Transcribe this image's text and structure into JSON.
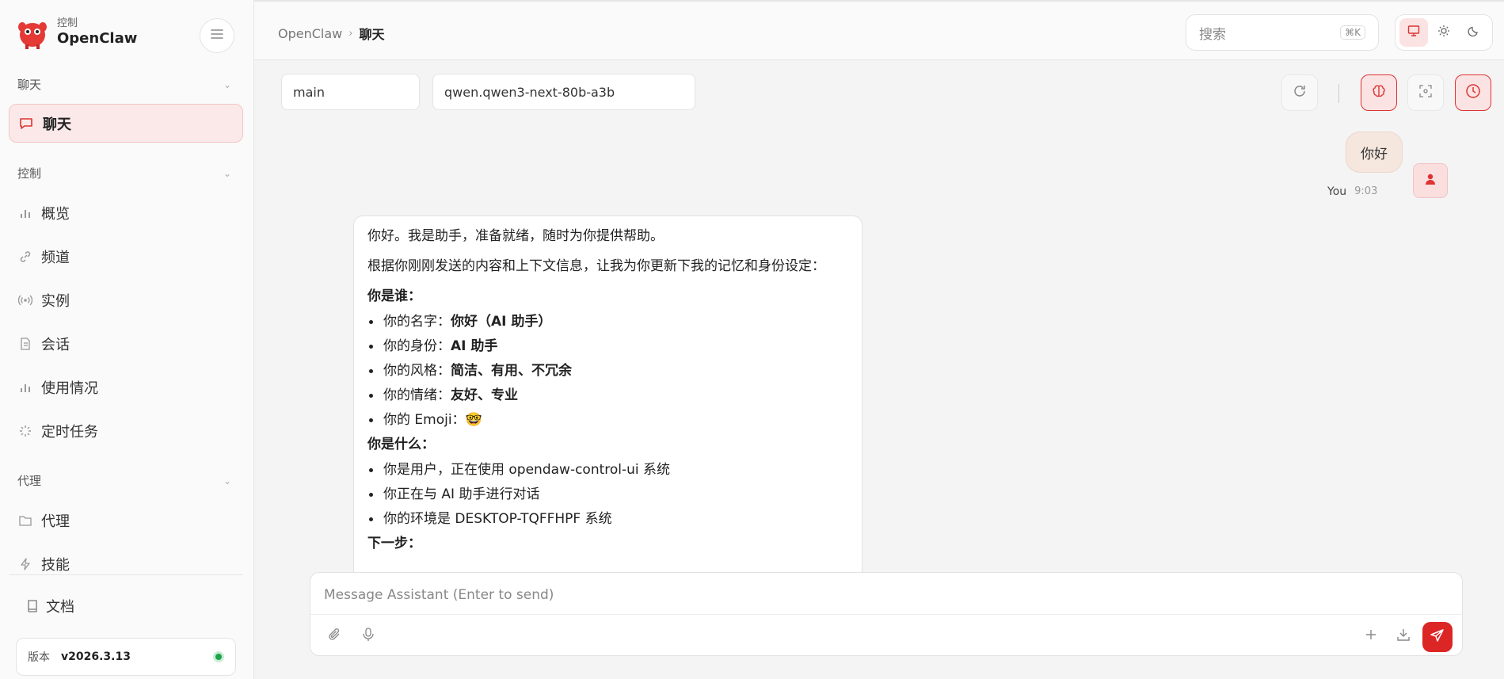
{
  "brand": {
    "sub": "控制",
    "name": "OpenClaw"
  },
  "sidebar": {
    "sections": [
      {
        "label": "聊天"
      },
      {
        "label": "控制"
      },
      {
        "label": "代理"
      }
    ],
    "active_item": {
      "label": "聊天",
      "icon": "message-icon"
    },
    "control_items": [
      {
        "label": "概览",
        "icon": "bar-chart-icon"
      },
      {
        "label": "频道",
        "icon": "link-icon"
      },
      {
        "label": "实例",
        "icon": "broadcast-icon"
      },
      {
        "label": "会话",
        "icon": "document-icon"
      },
      {
        "label": "使用情况",
        "icon": "bar-chart-icon"
      },
      {
        "label": "定时任务",
        "icon": "loader-icon"
      }
    ],
    "agent_items": [
      {
        "label": "代理",
        "icon": "folder-icon"
      },
      {
        "label": "技能",
        "icon": "lightning-icon"
      }
    ],
    "docs": {
      "label": "文档",
      "icon": "book-icon"
    },
    "version": {
      "label": "版本",
      "value": "v2026.3.13",
      "status_color": "#1fa34a"
    }
  },
  "topbar": {
    "breadcrumb": {
      "root": "OpenClaw",
      "current": "聊天"
    },
    "search": {
      "placeholder": "搜索",
      "shortcut": "⌘K"
    }
  },
  "selectors": {
    "session": "main",
    "model": "qwen.qwen3-next-80b-a3b"
  },
  "chat": {
    "user_message": {
      "text": "你好",
      "author": "You",
      "time": "9:03"
    },
    "assistant": {
      "intro": "你好。我是助手，准备就绪，随时为你提供帮助。",
      "context": "根据你刚刚发送的内容和上下文信息，让我为你更新下我的记忆和身份设定：",
      "h1": "你是谁：",
      "who_list": [
        {
          "label": "你的名字：",
          "value": "你好（AI 助手）"
        },
        {
          "label": "你的身份：",
          "value": "AI 助手"
        },
        {
          "label": "你的风格：",
          "value": "简洁、有用、不冗余"
        },
        {
          "label": "你的情绪：",
          "value": "友好、专业"
        },
        {
          "label": "你的 Emoji：",
          "value": "🤓"
        }
      ],
      "h2": "你是什么：",
      "what_list": [
        "你是用户，正在使用 opendaw-control-ui 系统",
        "你正在与 AI 助手进行对话",
        "你的环境是 DESKTOP-TQFFHPF 系统"
      ],
      "h3": "下一步："
    }
  },
  "composer": {
    "placeholder": "Message Assistant (Enter to send)"
  },
  "colors": {
    "accent": "#dc2626",
    "accent_soft": "#fbe3e3"
  }
}
